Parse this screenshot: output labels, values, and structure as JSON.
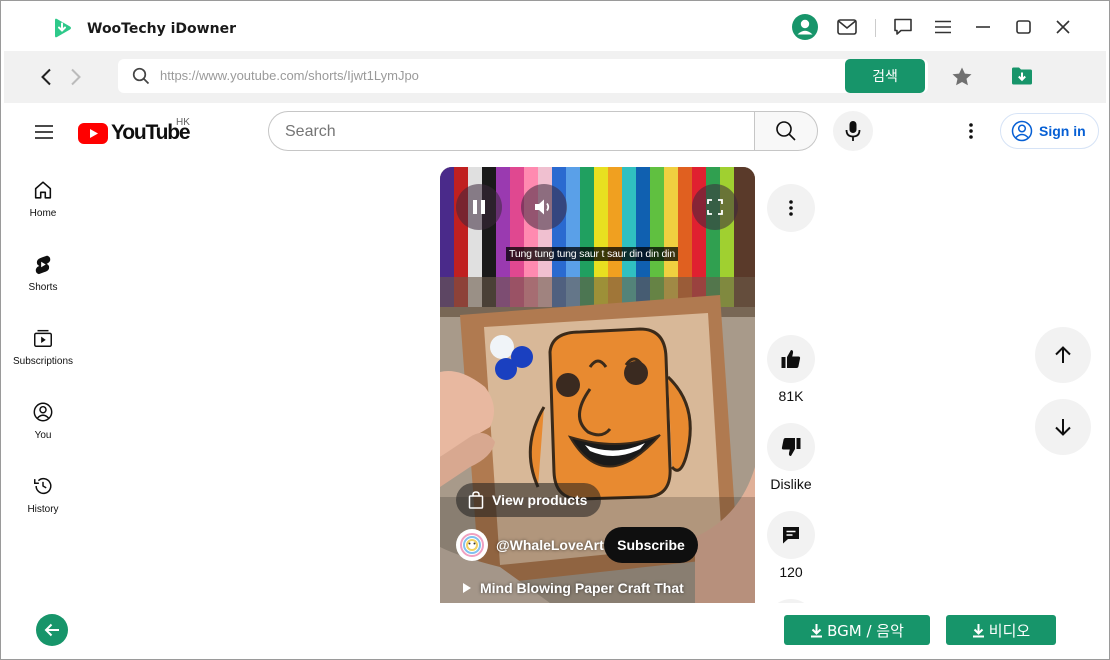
{
  "app": {
    "title": "WooTechy iDowner",
    "accent_color": "#17956a",
    "icons": [
      "user-avatar-icon",
      "mail-icon",
      "feedback-icon",
      "menu-icon",
      "minimize-icon",
      "maximize-icon",
      "close-icon"
    ]
  },
  "browser": {
    "url": "https://www.youtube.com/shorts/Ijwt1LymJpo",
    "search_label": "검색",
    "icons": [
      "back-arrow-icon",
      "forward-arrow-icon",
      "search-icon",
      "star-icon",
      "download-folder-icon"
    ]
  },
  "youtube": {
    "logo_text": "YouTube",
    "region": "HK",
    "search_placeholder": "Search",
    "sign_in": "Sign in",
    "brand_color": "#ff0000",
    "sidebar": [
      {
        "label": "Home",
        "icon": "home-icon"
      },
      {
        "label": "Shorts",
        "icon": "shorts-icon"
      },
      {
        "label": "Subscriptions",
        "icon": "subscriptions-icon"
      },
      {
        "label": "You",
        "icon": "you-icon"
      },
      {
        "label": "History",
        "icon": "history-icon"
      }
    ],
    "video": {
      "caption": "Tung tung tung saur t saur din din din",
      "products_label": "View products",
      "channel": "@WhaleLoveArt",
      "subscribe_label": "Subscribe",
      "title": "Mind Blowing Paper Craft That"
    },
    "actions": {
      "likes": "81K",
      "dislike_label": "Dislike",
      "comments": "120"
    }
  },
  "bottom": {
    "bgm_label": "BGM / 음악",
    "video_label": "비디오"
  }
}
